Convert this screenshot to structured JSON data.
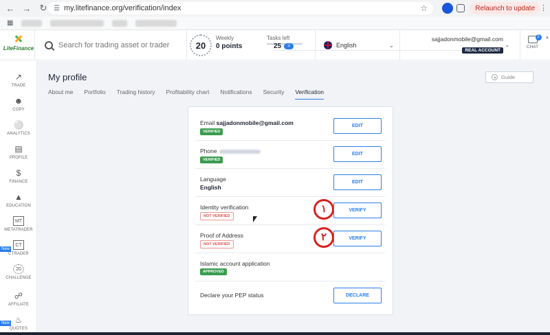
{
  "browser": {
    "url": "my.litefinance.org/verification/index",
    "relaunch_label": "Relaunch to update"
  },
  "header": {
    "logo_text": "LiteFinance",
    "search_placeholder": "Search for trading asset or trader",
    "level_badge": "20",
    "weekly_label": "Weekly",
    "weekly_value": "0 points",
    "tasks_label": "Tasks left",
    "tasks_value": "25",
    "language": "English",
    "account_email": "sajjadonmobile@gmail.com",
    "account_type": "REAL ACCOUNT",
    "chat_label": "CHAT",
    "chat_count": "2"
  },
  "sidebar": {
    "new_label": "New",
    "items": [
      {
        "label": "TRADE",
        "icon": "chart-icon"
      },
      {
        "label": "COPY",
        "icon": "copy-icon"
      },
      {
        "label": "ANALYTICS",
        "icon": "analytics-icon"
      },
      {
        "label": "PROFILE",
        "icon": "profile-icon"
      },
      {
        "label": "FINANCE",
        "icon": "dollar-icon"
      },
      {
        "label": "EDUCATION",
        "icon": "graduation-icon"
      },
      {
        "label": "METATRADER",
        "icon": "mt-icon"
      },
      {
        "label": "CTRADER",
        "icon": "ct-icon"
      },
      {
        "label": "CHALLENGE",
        "icon": "challenge-icon"
      },
      {
        "label": "AFFILIATE",
        "icon": "handshake-icon"
      },
      {
        "label": "QUOTES",
        "icon": "quotes-icon"
      }
    ]
  },
  "page": {
    "title": "My profile",
    "guide_label": "Guide",
    "tabs": [
      "About me",
      "Portfolio",
      "Trading history",
      "Profitability chart",
      "Notifications",
      "Security",
      "Verification"
    ]
  },
  "verification": {
    "email_label": "Email",
    "email_value": "sajjadonmobile@gmail.com",
    "email_status": "VERIFIED",
    "phone_label": "Phone",
    "phone_status": "VERIFIED",
    "language_label": "Language",
    "language_value": "English",
    "identity_label": "Identity verification",
    "identity_status": "NOT VERIFIED",
    "address_label": "Proof of Address",
    "address_status": "NOT VERIFIED",
    "islamic_label": "Islamic account application",
    "islamic_status": "APPROVED",
    "pep_label": "Declare your PEP status",
    "edit_label": "EDIT",
    "verify_label": "VERIFY",
    "declare_label": "DECLARE",
    "annotation_1": "١",
    "annotation_2": "٢"
  }
}
